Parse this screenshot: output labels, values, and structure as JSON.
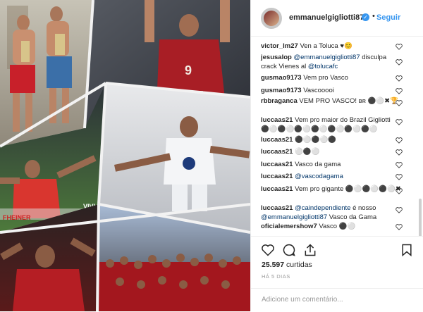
{
  "post": {
    "username": "emmanuelgigliotti87",
    "follow_label": "Seguir",
    "separator": "•",
    "verified_glyph": "✓"
  },
  "comments": [
    {
      "user": "victor_lm27",
      "text": " Ven a Toluca ♥😊"
    },
    {
      "user": "jesusalop",
      "mention": " @emmanuelgigliotti87",
      "text": " disculpa crack Vienes al ",
      "mention2": "@tolucafc"
    },
    {
      "user": "gusmao9173",
      "text": " Vem pro Vasco"
    },
    {
      "user": "gusmao9173",
      "text": " Vascooooi"
    },
    {
      "user": "rbbraganca",
      "text": " VEM PRO VASCO! ʙʀ ⚫⚪✖🏆"
    },
    {
      "user": "luccaas21",
      "text": " Vem pro maior do Brazil Gigliotti ⚫⚪⚫⚪⚫⚪⚫⚪⚫⚪⚫⚪⚫⚪"
    },
    {
      "user": "luccaas21",
      "text": " ⚫⚪⚫⚪⚫"
    },
    {
      "user": "luccaas21",
      "text": " ⚪⚫⚪"
    },
    {
      "user": "luccaas21",
      "text": " Vasco da gama"
    },
    {
      "user": "luccaas21",
      "mention": " @vascodagama"
    },
    {
      "user": "luccaas21",
      "text": " Vem pro gigante ⚫⚪⚫⚪⚫⚪✖"
    },
    {
      "user": "luccaas21",
      "mention": " @caindependiente",
      "text": " é nosso",
      "mention2": "@emmanuelgigliotti87",
      "text2": " Vasco da Gama"
    },
    {
      "user": "oficialemershow7",
      "text": " Vasco ⚫⚪"
    }
  ],
  "icons": [
    "heart-icon",
    "comment-icon",
    "share-icon",
    "bookmark-icon"
  ],
  "likes": {
    "count": "25.597",
    "label": "curtidas"
  },
  "time_ago": "HÁ 5 DIAS",
  "add_comment_placeholder": "Adicione um comentário..."
}
